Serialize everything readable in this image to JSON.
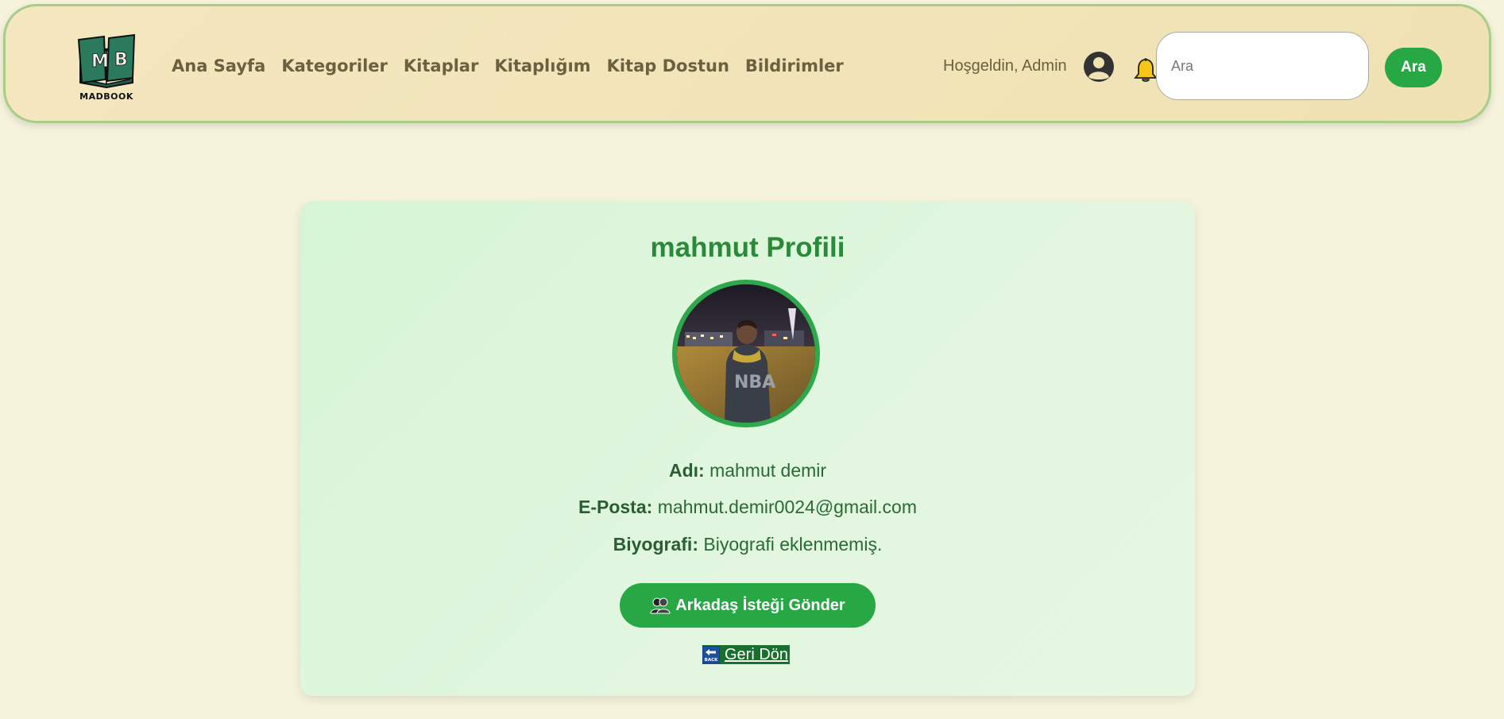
{
  "header": {
    "logo_text": "MADBOOK",
    "nav": [
      {
        "label": "Ana Sayfa"
      },
      {
        "label": "Kategoriler"
      },
      {
        "label": "Kitaplar"
      },
      {
        "label": "Kitaplığım"
      },
      {
        "label": "Kitap Dostun"
      },
      {
        "label": "Bildirimler"
      }
    ],
    "welcome_text": "Hoşgeldin, Admin",
    "search_placeholder": "Ara",
    "search_value": "",
    "search_button": "Ara",
    "icons": {
      "user": "user-circle-icon",
      "bell": "bell-icon"
    }
  },
  "profile": {
    "title": "mahmut Profili",
    "name_label": "Adı:",
    "name_value": "mahmut demir",
    "email_label": "E-Posta:",
    "email_value": "mahmut.demir0024@gmail.com",
    "bio_label": "Biyografi:",
    "bio_value": "Biyografi eklenmemiş.",
    "friend_request_button": "Arkadaş İsteği Gönder",
    "back_link": "Geri Dön",
    "back_icon_text": "BACK"
  },
  "colors": {
    "page_bg": "#f5f3dc",
    "header_bg": "#f2e5b9",
    "header_border": "#a8cd86",
    "accent_green": "#28a745",
    "title_green": "#2a8a3a",
    "card_bg": "#dcf5dc",
    "nav_text": "#6b6040"
  }
}
